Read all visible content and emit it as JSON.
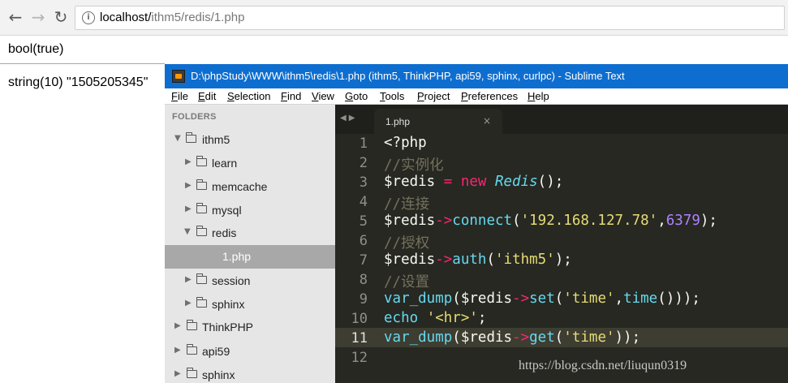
{
  "browser": {
    "back_icon": "back-arrow-icon",
    "forward_icon": "forward-arrow-icon",
    "reload_icon": "reload-icon",
    "url_host": "localhost/",
    "url_path": "ithm5/redis/1.php"
  },
  "page": {
    "bool_output": "bool(true)",
    "string_output": "string(10) \"1505205345\""
  },
  "sublime": {
    "title": "D:\\phpStudy\\WWW\\ithm5\\redis\\1.php (ithm5, ThinkPHP, api59, sphinx, curlpc) - Sublime Text",
    "menu": [
      "File",
      "Edit",
      "Selection",
      "Find",
      "View",
      "Goto",
      "Tools",
      "Project",
      "Preferences",
      "Help"
    ],
    "sidebar": {
      "header": "FOLDERS",
      "items": [
        {
          "label": "ithm5",
          "expanded": true
        },
        {
          "label": "learn",
          "expanded": false
        },
        {
          "label": "memcache",
          "expanded": false
        },
        {
          "label": "mysql",
          "expanded": false
        },
        {
          "label": "redis",
          "expanded": true
        },
        {
          "label": "1.php",
          "selected": true
        },
        {
          "label": "session",
          "expanded": false
        },
        {
          "label": "sphinx",
          "expanded": false
        },
        {
          "label": "ThinkPHP",
          "expanded": false
        },
        {
          "label": "api59",
          "expanded": false
        },
        {
          "label": "sphinx",
          "expanded": false
        }
      ]
    },
    "tab": {
      "name": "1.php",
      "close": "×",
      "nav": "◀▶"
    },
    "current_line": 11,
    "line_numbers": [
      "1",
      "2",
      "3",
      "4",
      "5",
      "6",
      "7",
      "8",
      "9",
      "10",
      "11",
      "12"
    ],
    "code": {
      "l1": "<?php",
      "l2": "//实例化",
      "l3_var": "$redis",
      "l3_eq": " = ",
      "l3_new": "new",
      "l3_cls": "Redis",
      "l3_end": "();",
      "l4": "//连接",
      "l5_var": "$redis",
      "l5_arrow": "->",
      "l5_fn": "connect",
      "l5_open": "(",
      "l5_str": "'192.168.127.78'",
      "l5_comma": ",",
      "l5_num": "6379",
      "l5_end": ");",
      "l6": "//授权",
      "l7_var": "$redis",
      "l7_arrow": "->",
      "l7_fn": "auth",
      "l7_open": "(",
      "l7_str": "'ithm5'",
      "l7_end": ");",
      "l8": "//设置",
      "l9_fn": "var_dump",
      "l9_open": "(",
      "l9_var": "$redis",
      "l9_arrow": "->",
      "l9_fn2": "set",
      "l9_open2": "(",
      "l9_str": "'time'",
      "l9_comma": ",",
      "l9_fn3": "time",
      "l9_end": "()));",
      "l10_fn": "echo",
      "l10_sp": " ",
      "l10_str": "'<hr>'",
      "l10_end": ";",
      "l11_fn": "var_dump",
      "l11_open": "(",
      "l11_var": "$redis",
      "l11_arrow": "->",
      "l11_fn2": "get",
      "l11_open2": "(",
      "l11_str": "'time'",
      "l11_end": "));"
    }
  },
  "watermark": "https://blog.csdn.net/liuqun0319",
  "colors": {
    "titlebar": "#0e6ed0",
    "editor_bg": "#272822",
    "keyword": "#f92672",
    "function": "#66d9ef",
    "string": "#e6db74",
    "number": "#ae81ff",
    "comment": "#75715e"
  }
}
